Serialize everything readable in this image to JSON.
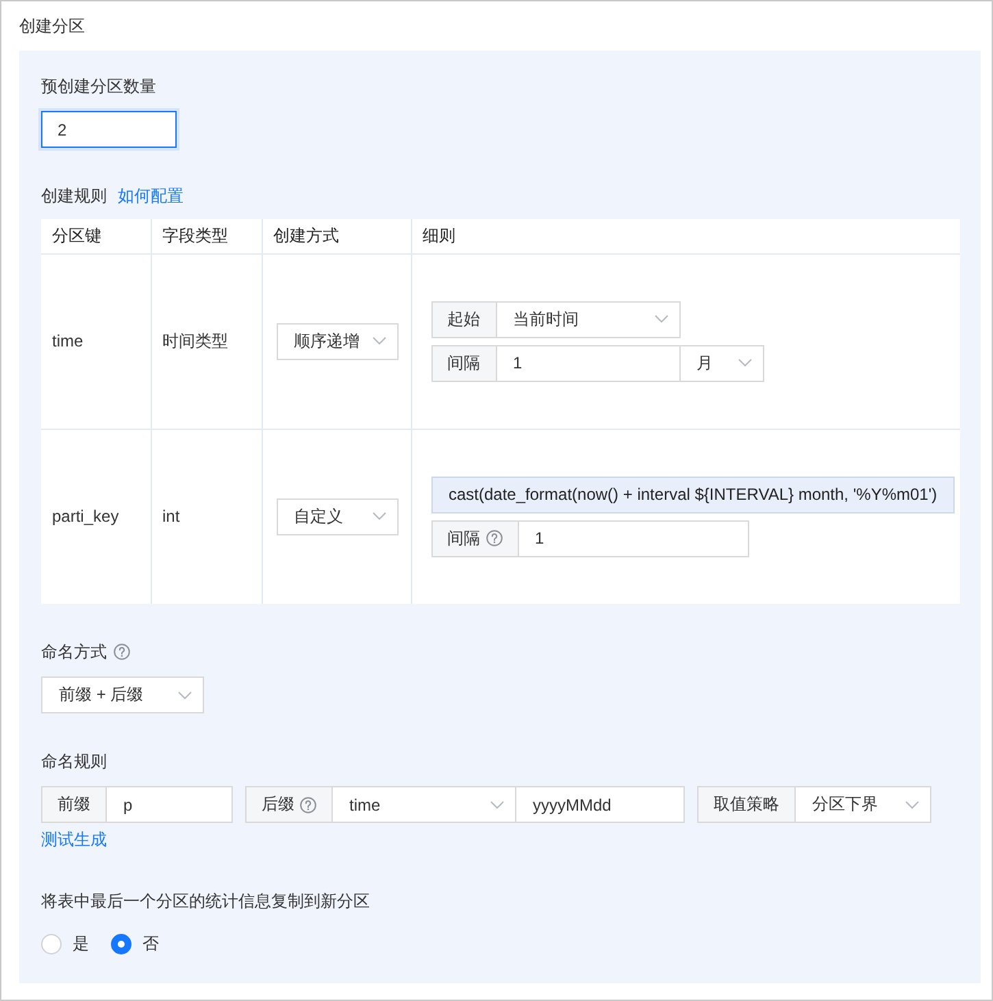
{
  "title": "创建分区",
  "precreate": {
    "label": "预创建分区数量",
    "value": "2",
    "focused": true
  },
  "rules": {
    "label": "创建规则",
    "link": "如何配置",
    "columns": [
      "分区键",
      "字段类型",
      "创建方式",
      "细则"
    ],
    "rows": [
      {
        "key": "time",
        "field_type": "时间类型",
        "method": "顺序递增",
        "details": [
          [
            {
              "kind": "addon",
              "text": "起始",
              "help": false
            },
            {
              "kind": "select",
              "value": "当前时间"
            }
          ],
          [
            {
              "kind": "addon",
              "text": "间隔",
              "help": false
            },
            {
              "kind": "input",
              "value": "1"
            },
            {
              "kind": "select",
              "value": "月"
            }
          ]
        ]
      },
      {
        "key": "parti_key",
        "field_type": "int",
        "method": "自定义",
        "details": [
          [
            {
              "kind": "expression",
              "text": "cast(date_format(now() + interval ${INTERVAL} month, '%Y%m01')"
            }
          ],
          [
            {
              "kind": "addon",
              "text": "间隔",
              "help": true
            },
            {
              "kind": "input",
              "value": "1"
            }
          ]
        ]
      }
    ]
  },
  "naming_method": {
    "label": "命名方式",
    "help": true,
    "value": "前缀 + 后缀"
  },
  "naming_rule": {
    "label": "命名规则",
    "groups": [
      [
        {
          "kind": "addon",
          "text": "前缀",
          "help": false
        },
        {
          "kind": "input",
          "value": "p"
        }
      ],
      [
        {
          "kind": "addon",
          "text": "后缀",
          "help": true
        },
        {
          "kind": "select",
          "value": "time"
        },
        {
          "kind": "input",
          "value": "yyyyMMdd"
        }
      ],
      [
        {
          "kind": "addon",
          "text": "取值策略",
          "help": false
        },
        {
          "kind": "select",
          "value": "分区下界"
        }
      ]
    ],
    "link": "测试生成"
  },
  "copy_stats": {
    "label": "将表中最后一个分区的统计信息复制到新分区",
    "options": [
      {
        "label": "是",
        "selected": false
      },
      {
        "label": "否",
        "selected": true
      }
    ]
  }
}
